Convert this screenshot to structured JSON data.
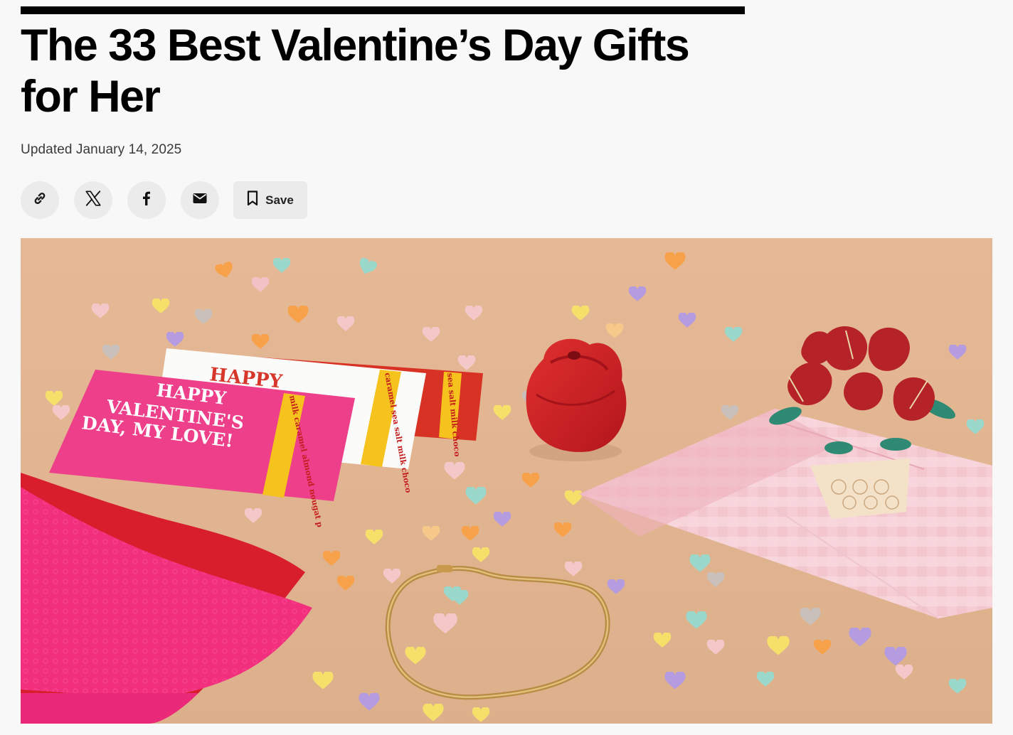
{
  "article": {
    "title": "The 33 Best Valentine’s Day Gifts for Her",
    "updated": "Updated January 14, 2025"
  },
  "share": {
    "buttons": [
      {
        "name": "copy-link",
        "icon": "link-icon"
      },
      {
        "name": "share-x",
        "icon": "x-logo-icon"
      },
      {
        "name": "share-facebook",
        "icon": "facebook-icon"
      },
      {
        "name": "share-email",
        "icon": "mail-icon"
      }
    ],
    "save_label": "Save",
    "save_icon": "bookmark-icon"
  },
  "hero": {
    "bar_front": {
      "line1": "HAPPY",
      "line2": "VALENTINE'S",
      "line3": "DAY, MY LOVE!",
      "band": "milk caramel almond nougat p"
    },
    "bar_middle": {
      "line1": "HAPPY",
      "band": "caramel sea salt milk choco"
    },
    "bar_back": {
      "band": "sea salt milk choco"
    }
  },
  "colors": {
    "background": "#f8f8f8",
    "button_bg": "#ebebeb",
    "backdrop": "#e2b694"
  }
}
